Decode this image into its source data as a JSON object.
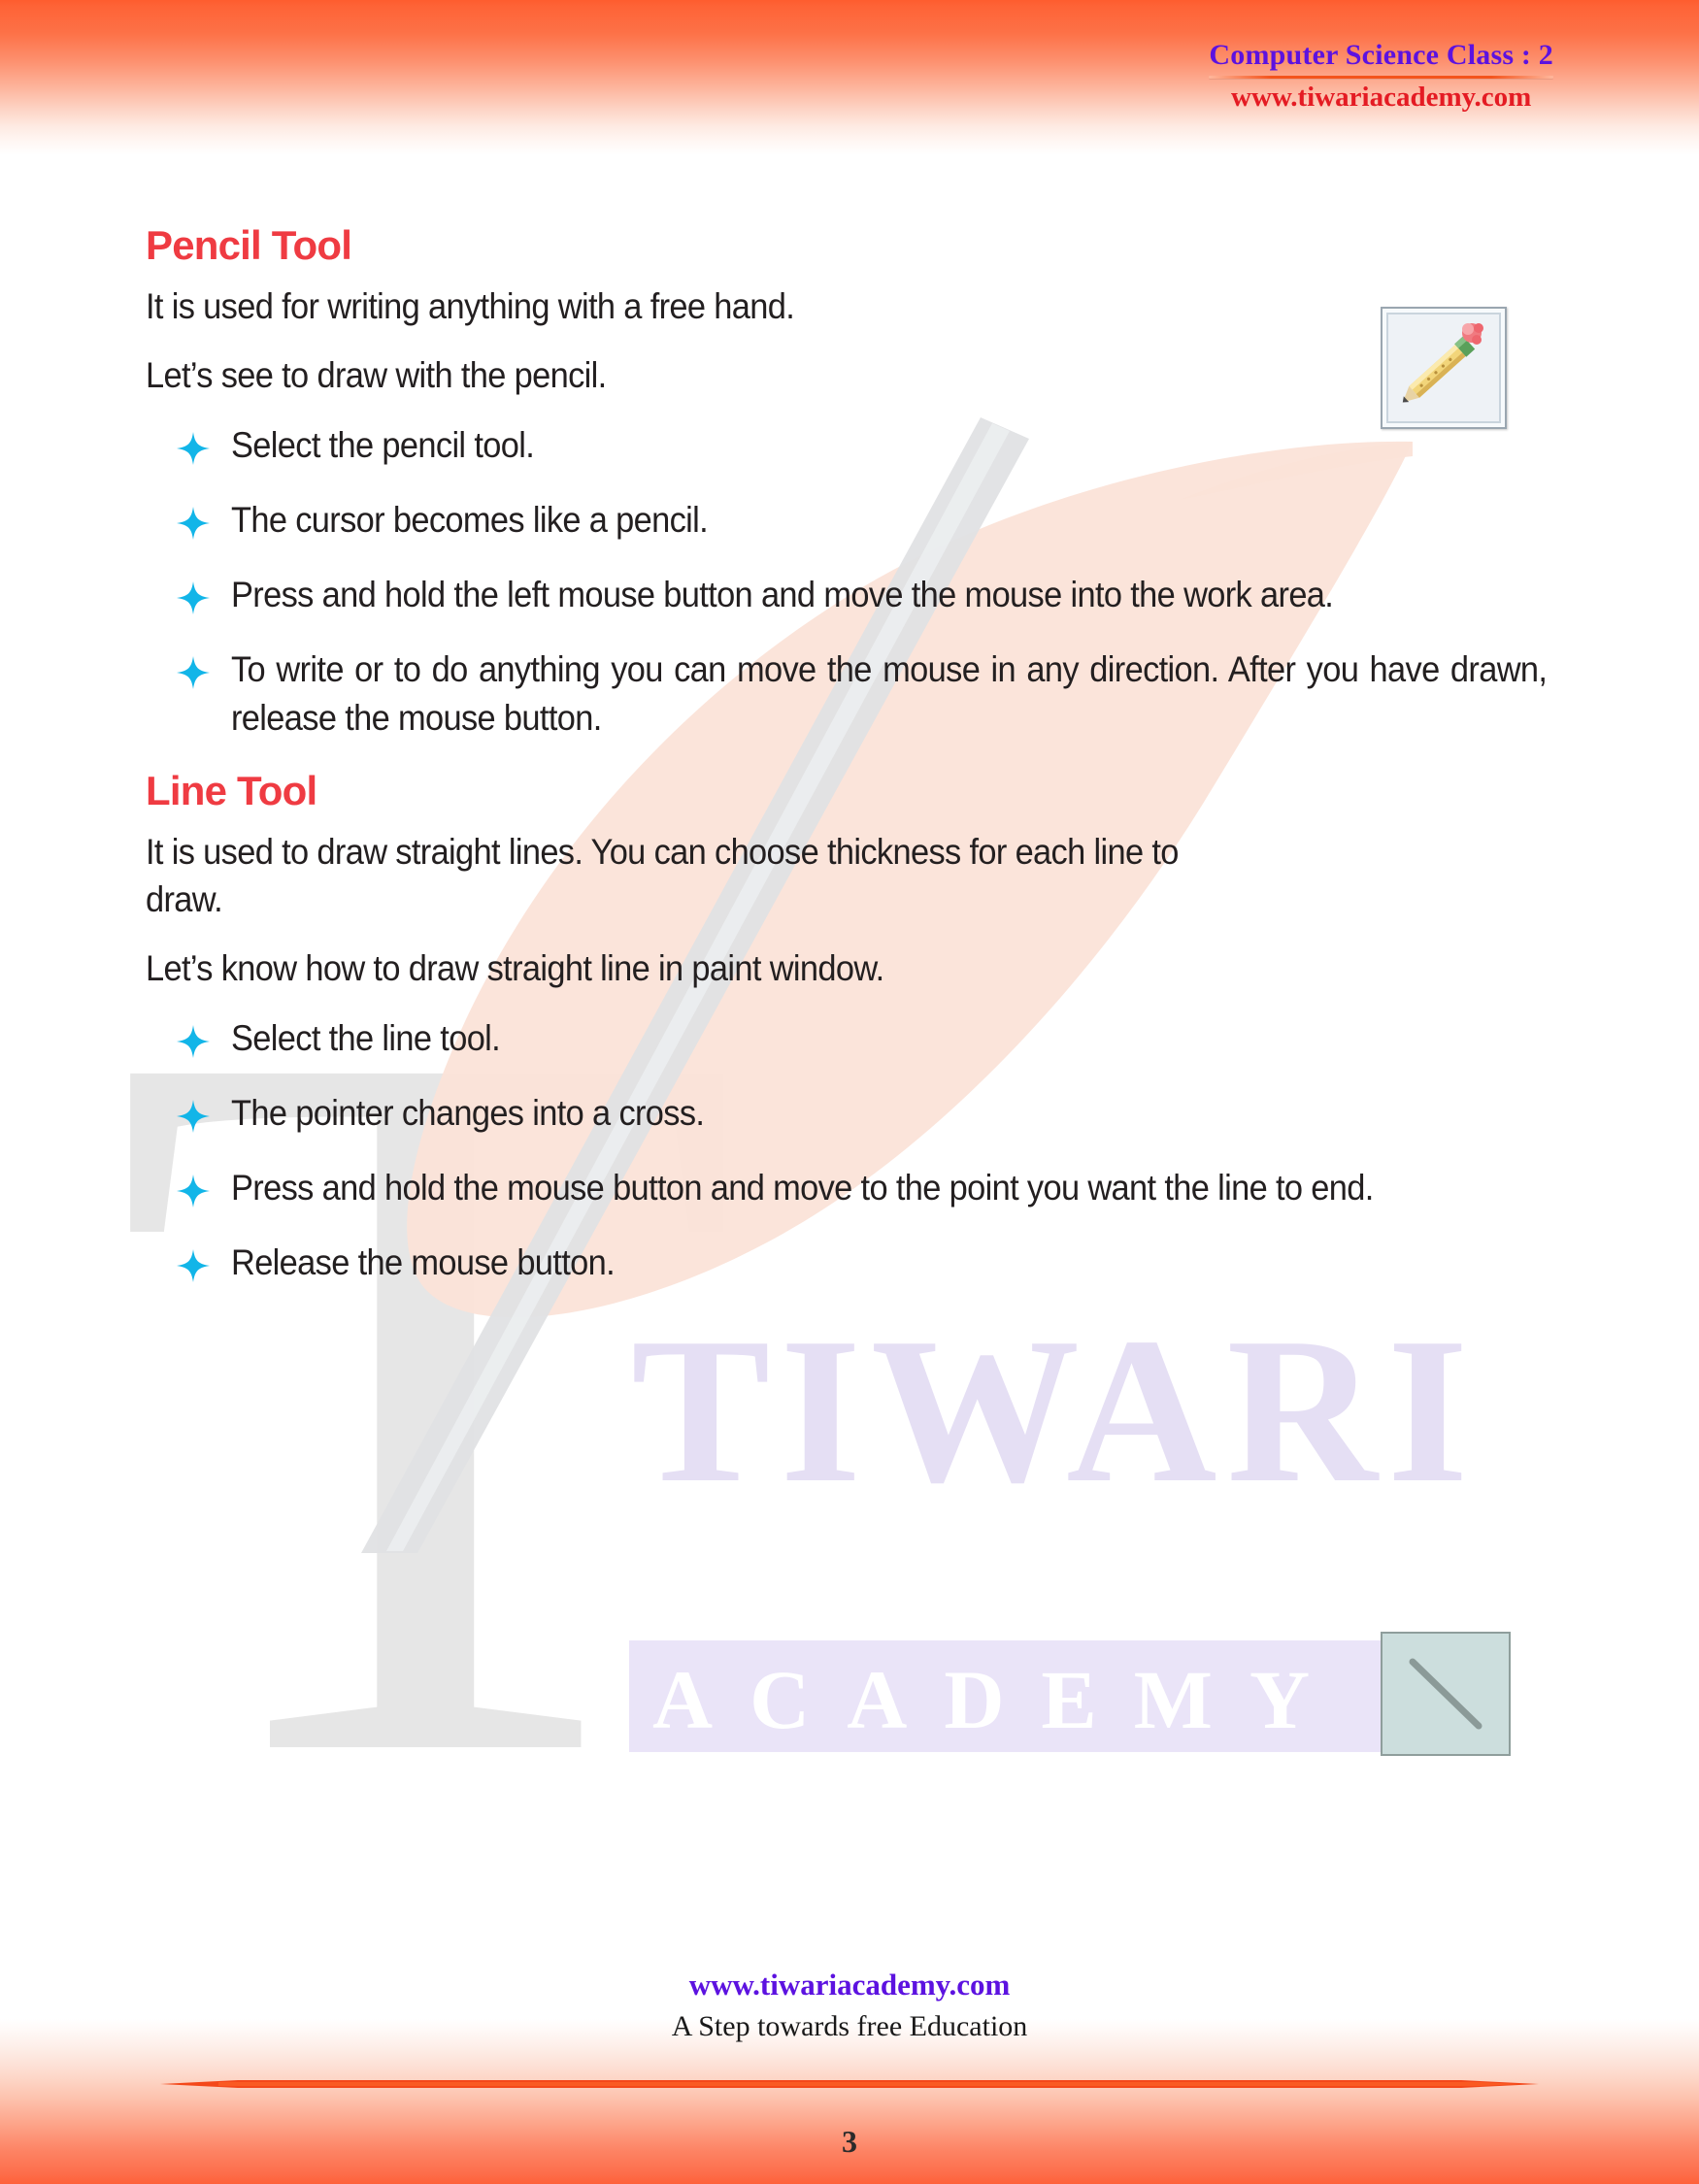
{
  "header": {
    "title": "Computer Science Class : 2",
    "site": "www.tiwariacademy.com",
    "title_color": "#5c12e0",
    "site_color": "#e41b23",
    "rule_color": "#f4541c"
  },
  "theme": {
    "band_orange": "#fe5c2e",
    "heading_red": "#ef3b42",
    "body_text": "#231f20",
    "bullet_cyan": "#12b5e8",
    "watermark_peach": "#fbe4da",
    "watermark_gray": "#e3e3e3",
    "watermark_purple": "#e7e2f6"
  },
  "sections": [
    {
      "heading": "Pencil Tool",
      "icon_name": "pencil-tool-icon",
      "paragraphs": [
        "It is used for writing anything with a free hand.",
        "Let’s see to draw with the pencil."
      ],
      "bullets": [
        "Select the pencil tool.",
        "The cursor becomes like a pencil.",
        "Press and hold the left mouse button and move the mouse into the work area.",
        "To write or to do anything you can move the mouse in any direction. After you have drawn, release the mouse button."
      ],
      "bullet_icon": "sparkle-bullet-icon"
    },
    {
      "heading": "Line Tool",
      "icon_name": "line-tool-icon",
      "paragraphs": [
        "It is used to draw straight lines. You can choose  thickness for each line to draw.",
        "Let’s know how to draw straight line in paint window."
      ],
      "bullets": [
        "Select the line tool.",
        "The pointer changes into a cross.",
        "Press and hold the mouse button and move to the point you want the line to end.",
        "Release the mouse button."
      ],
      "bullet_icon": "sparkle-bullet-icon"
    }
  ],
  "watermark": {
    "brand_line1": "TIWARI",
    "brand_line2": "ACADEMY",
    "letter": "T",
    "shape": "feather-quill"
  },
  "footer": {
    "site": "www.tiwariacademy.com",
    "tagline": "A Step towards free Education",
    "page_number": "3"
  }
}
